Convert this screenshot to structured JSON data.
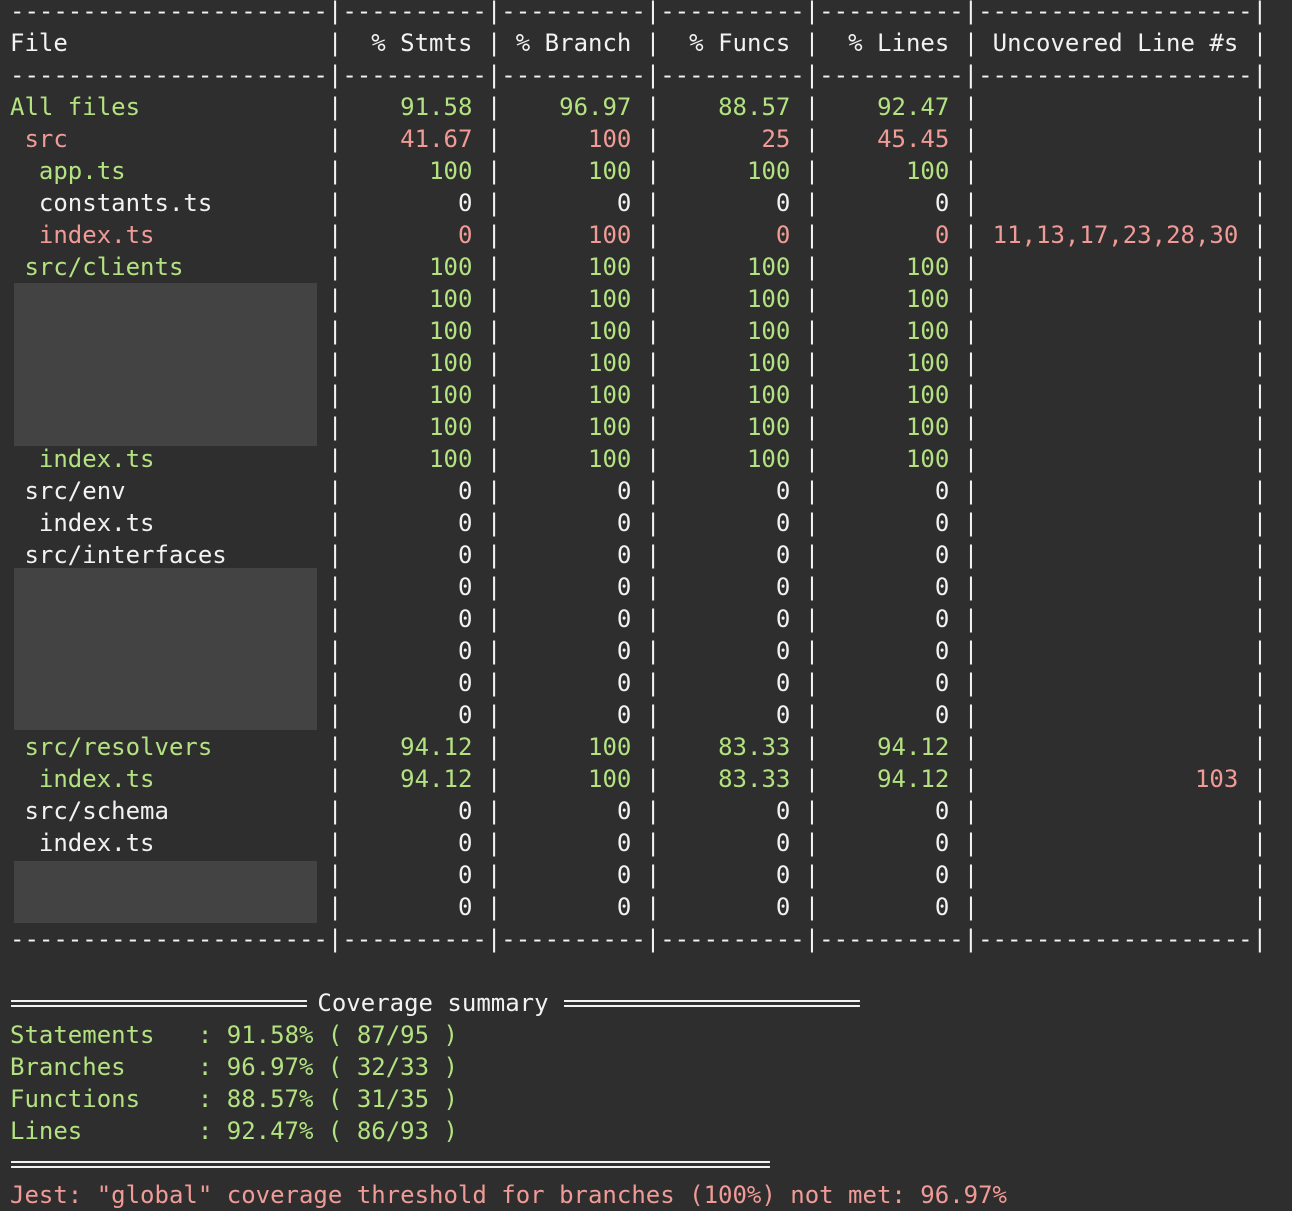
{
  "colors": {
    "background": "#2e2e2e",
    "green": "#b3e280",
    "red": "#f19b97",
    "white": "#f2f2f2",
    "redaction": "#434343"
  },
  "divider": "----------------------|----------|----------|----------|----------|-------------------|",
  "header": {
    "file": "File",
    "stmts": "% Stmts",
    "branch": "% Branch",
    "funcs": "% Funcs",
    "lines": "% Lines",
    "uncovered": "Uncovered Line #s"
  },
  "rows": [
    {
      "file": "All files",
      "indent": 0,
      "stmts": "91.58",
      "branch": "96.97",
      "funcs": "88.57",
      "lines": "92.47",
      "uncovered": "",
      "color": "g"
    },
    {
      "file": "src",
      "indent": 1,
      "stmts": "41.67",
      "branch": "100",
      "funcs": "25",
      "lines": "45.45",
      "uncovered": "",
      "color": "r"
    },
    {
      "file": "app.ts",
      "indent": 2,
      "stmts": "100",
      "branch": "100",
      "funcs": "100",
      "lines": "100",
      "uncovered": "",
      "color": "g"
    },
    {
      "file": "constants.ts",
      "indent": 2,
      "stmts": "0",
      "branch": "0",
      "funcs": "0",
      "lines": "0",
      "uncovered": "",
      "color": "w"
    },
    {
      "file": "index.ts",
      "indent": 2,
      "stmts": "0",
      "branch": "100",
      "funcs": "0",
      "lines": "0",
      "uncovered": "11,13,17,23,28,30",
      "color": "r"
    },
    {
      "file": "src/clients",
      "indent": 1,
      "stmts": "100",
      "branch": "100",
      "funcs": "100",
      "lines": "100",
      "uncovered": "",
      "color": "g"
    },
    {
      "file": "",
      "indent": 2,
      "stmts": "100",
      "branch": "100",
      "funcs": "100",
      "lines": "100",
      "uncovered": "",
      "color": "g"
    },
    {
      "file": "",
      "indent": 2,
      "stmts": "100",
      "branch": "100",
      "funcs": "100",
      "lines": "100",
      "uncovered": "",
      "color": "g"
    },
    {
      "file": "",
      "indent": 2,
      "stmts": "100",
      "branch": "100",
      "funcs": "100",
      "lines": "100",
      "uncovered": "",
      "color": "g"
    },
    {
      "file": "",
      "indent": 2,
      "stmts": "100",
      "branch": "100",
      "funcs": "100",
      "lines": "100",
      "uncovered": "",
      "color": "g"
    },
    {
      "file": "",
      "indent": 2,
      "stmts": "100",
      "branch": "100",
      "funcs": "100",
      "lines": "100",
      "uncovered": "",
      "color": "g"
    },
    {
      "file": "index.ts",
      "indent": 2,
      "stmts": "100",
      "branch": "100",
      "funcs": "100",
      "lines": "100",
      "uncovered": "",
      "color": "g"
    },
    {
      "file": "src/env",
      "indent": 1,
      "stmts": "0",
      "branch": "0",
      "funcs": "0",
      "lines": "0",
      "uncovered": "",
      "color": "w"
    },
    {
      "file": "index.ts",
      "indent": 2,
      "stmts": "0",
      "branch": "0",
      "funcs": "0",
      "lines": "0",
      "uncovered": "",
      "color": "w"
    },
    {
      "file": "src/interfaces",
      "indent": 1,
      "stmts": "0",
      "branch": "0",
      "funcs": "0",
      "lines": "0",
      "uncovered": "",
      "color": "w"
    },
    {
      "file": "",
      "indent": 2,
      "stmts": "0",
      "branch": "0",
      "funcs": "0",
      "lines": "0",
      "uncovered": "",
      "color": "w"
    },
    {
      "file": "",
      "indent": 2,
      "stmts": "0",
      "branch": "0",
      "funcs": "0",
      "lines": "0",
      "uncovered": "",
      "color": "w"
    },
    {
      "file": "",
      "indent": 2,
      "stmts": "0",
      "branch": "0",
      "funcs": "0",
      "lines": "0",
      "uncovered": "",
      "color": "w"
    },
    {
      "file": "",
      "indent": 2,
      "stmts": "0",
      "branch": "0",
      "funcs": "0",
      "lines": "0",
      "uncovered": "",
      "color": "w"
    },
    {
      "file": "",
      "indent": 2,
      "stmts": "0",
      "branch": "0",
      "funcs": "0",
      "lines": "0",
      "uncovered": "",
      "color": "w"
    },
    {
      "file": "src/resolvers",
      "indent": 1,
      "stmts": "94.12",
      "branch": "100",
      "funcs": "83.33",
      "lines": "94.12",
      "uncovered": "",
      "color": "g"
    },
    {
      "file": "index.ts",
      "indent": 2,
      "stmts": "94.12",
      "branch": "100",
      "funcs": "83.33",
      "lines": "94.12",
      "uncovered": "103",
      "color": "g"
    },
    {
      "file": "src/schema",
      "indent": 1,
      "stmts": "0",
      "branch": "0",
      "funcs": "0",
      "lines": "0",
      "uncovered": "",
      "color": "w"
    },
    {
      "file": "index.ts",
      "indent": 2,
      "stmts": "0",
      "branch": "0",
      "funcs": "0",
      "lines": "0",
      "uncovered": "",
      "color": "w"
    },
    {
      "file": "",
      "indent": 2,
      "stmts": "0",
      "branch": "0",
      "funcs": "0",
      "lines": "0",
      "uncovered": "",
      "color": "w"
    },
    {
      "file": "",
      "indent": 2,
      "stmts": "0",
      "branch": "0",
      "funcs": "0",
      "lines": "0",
      "uncovered": "",
      "color": "w"
    }
  ],
  "summary": {
    "header_left": "===============================",
    "header_title": "Coverage summary",
    "header_right": "===============================",
    "items": [
      {
        "label": "Statements",
        "value": "91.58%",
        "fraction": "87/95"
      },
      {
        "label": "Branches",
        "value": "96.97%",
        "fraction": "32/33"
      },
      {
        "label": "Functions",
        "value": "88.57%",
        "fraction": "31/35"
      },
      {
        "label": "Lines",
        "value": "92.47%",
        "fraction": "86/93"
      }
    ],
    "footer": "================================================================================"
  },
  "error_message": "Jest: \"global\" coverage threshold for branches (100%) not met: 96.97%"
}
